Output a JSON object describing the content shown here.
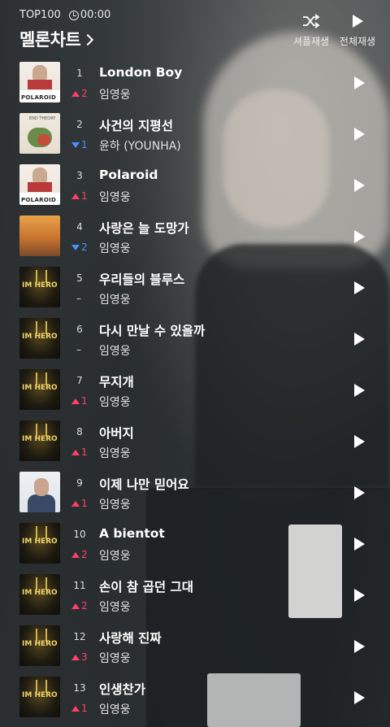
{
  "header": {
    "chart_label": "TOP100",
    "time": "00:00",
    "title": "멜론차트",
    "shuffle_label": "셔플재생",
    "play_all_label": "전체재생"
  },
  "tracks": [
    {
      "rank": "1",
      "change_dir": "up",
      "change": "2",
      "title": "London Boy",
      "artist": "임영웅",
      "art": "polaroid"
    },
    {
      "rank": "2",
      "change_dir": "down",
      "change": "1",
      "title": "사건의 지평선",
      "artist": "윤하 (YOUNHA)",
      "art": "younha"
    },
    {
      "rank": "3",
      "change_dir": "up",
      "change": "1",
      "title": "Polaroid",
      "artist": "임영웅",
      "art": "polaroid"
    },
    {
      "rank": "4",
      "change_dir": "down",
      "change": "2",
      "title": "사랑은 늘 도망가",
      "artist": "임영웅",
      "art": "dog"
    },
    {
      "rank": "5",
      "change_dir": "same",
      "change": "–",
      "title": "우리들의 블루스",
      "artist": "임영웅",
      "art": "hero"
    },
    {
      "rank": "6",
      "change_dir": "same",
      "change": "–",
      "title": "다시 만날 수 있을까",
      "artist": "임영웅",
      "art": "hero"
    },
    {
      "rank": "7",
      "change_dir": "up",
      "change": "1",
      "title": "무지개",
      "artist": "임영웅",
      "art": "hero"
    },
    {
      "rank": "8",
      "change_dir": "up",
      "change": "1",
      "title": "아버지",
      "artist": "임영웅",
      "art": "hero"
    },
    {
      "rank": "9",
      "change_dir": "up",
      "change": "1",
      "title": "이제 나만 믿어요",
      "artist": "임영웅",
      "art": "portrait"
    },
    {
      "rank": "10",
      "change_dir": "up",
      "change": "2",
      "title": "A bientot",
      "artist": "임영웅",
      "art": "hero"
    },
    {
      "rank": "11",
      "change_dir": "up",
      "change": "2",
      "title": "손이 참 곱던 그대",
      "artist": "임영웅",
      "art": "hero"
    },
    {
      "rank": "12",
      "change_dir": "up",
      "change": "3",
      "title": "사랑해 진짜",
      "artist": "임영웅",
      "art": "hero"
    },
    {
      "rank": "13",
      "change_dir": "up",
      "change": "1",
      "title": "인생찬가",
      "artist": "임영웅",
      "art": "hero"
    }
  ],
  "art_text": {
    "polaroid": "POLAROID",
    "hero": "IM HERO",
    "younha": "END THEORY"
  },
  "colors": {
    "up": "#ff3e6b",
    "down": "#4a90ff"
  }
}
